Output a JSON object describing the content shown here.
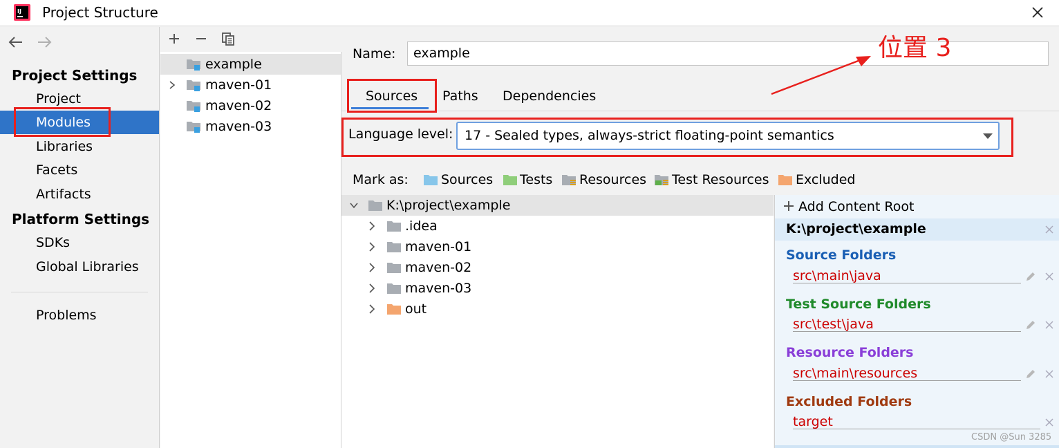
{
  "window": {
    "title": "Project Structure"
  },
  "nav": {
    "back_icon": "back-arrow-icon",
    "forward_icon": "forward-arrow-icon",
    "project_settings_title": "Project Settings",
    "project_settings": [
      "Project",
      "Modules",
      "Libraries",
      "Facets",
      "Artifacts"
    ],
    "platform_settings_title": "Platform Settings",
    "platform_settings": [
      "SDKs",
      "Global Libraries"
    ],
    "problems": "Problems",
    "selected": "Modules"
  },
  "modules": {
    "toolbar": [
      "add-icon",
      "remove-icon",
      "copy-icon"
    ],
    "items": [
      {
        "label": "example",
        "selected": true,
        "expandable": false
      },
      {
        "label": "maven-01",
        "selected": false,
        "expandable": true
      },
      {
        "label": "maven-02",
        "selected": false,
        "expandable": false
      },
      {
        "label": "maven-03",
        "selected": false,
        "expandable": false
      }
    ]
  },
  "details": {
    "name_label": "Name:",
    "name_value": "example",
    "tabs": [
      "Sources",
      "Paths",
      "Dependencies"
    ],
    "active_tab": "Sources",
    "language_level_label": "Language level:",
    "language_level_value": "17 - Sealed types, always-strict floating-point semantics",
    "mark_as_label": "Mark as:",
    "mark_as": [
      "Sources",
      "Tests",
      "Resources",
      "Test Resources",
      "Excluded"
    ]
  },
  "tree": {
    "root": "K:\\project\\example",
    "children": [
      ".idea",
      "maven-01",
      "maven-02",
      "maven-03",
      "out"
    ]
  },
  "content_roots": {
    "add_label": "Add Content Root",
    "root_path": "K:\\project\\example",
    "groups": [
      {
        "title": "Source Folders",
        "path": "src\\main\\java",
        "color": "#1a5fb4"
      },
      {
        "title": "Test Source Folders",
        "path": "src\\test\\java",
        "color": "#1f8a2a"
      },
      {
        "title": "Resource Folders",
        "path": "src\\main\\resources",
        "color": "#8a3fd8"
      },
      {
        "title": "Excluded Folders",
        "path": "target",
        "color": "#a03a10"
      }
    ]
  },
  "annotation": {
    "text": "位置 3",
    "color": "#e8201d"
  },
  "watermark": "CSDN @Sun 3285",
  "colors": {
    "selection": "#2f74c8",
    "accent": "#3d7ed8",
    "path_red": "#cc0000",
    "folder_blue": "#87c6ea",
    "folder_green": "#8fce7a",
    "folder_orange": "#f4a56e",
    "folder_gray": "#a8adb3"
  }
}
